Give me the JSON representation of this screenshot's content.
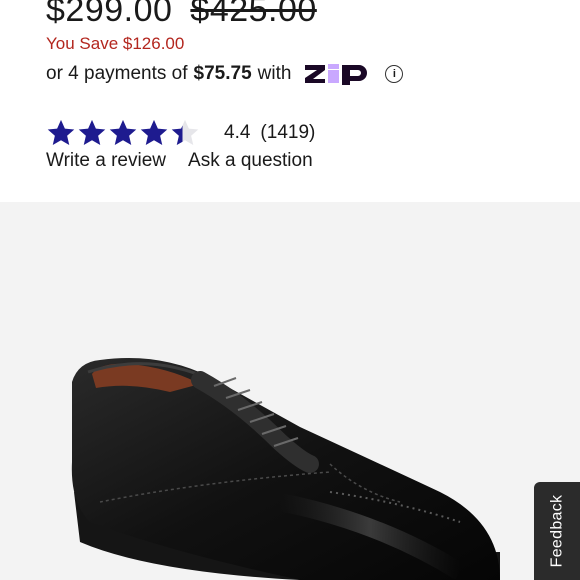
{
  "pricing": {
    "sale_price": "$299.00",
    "original_price": "$425.00",
    "savings": "You Save $126.00",
    "installments_prefix": "or 4 payments of",
    "installment_amount": "$75.75",
    "installments_suffix": "with",
    "provider_logo": "zip",
    "info_glyph": "i"
  },
  "rating": {
    "value": "4.4",
    "count": "(1419)",
    "stars_filled_fraction": 0.88,
    "star_color": "#1e1b8f",
    "write_review": "Write a review",
    "ask_question": "Ask a question"
  },
  "gallery": {
    "image": "black cap-toe oxford dress shoe",
    "background": "#f3f3f3"
  },
  "feedback": {
    "label": "Feedback"
  }
}
